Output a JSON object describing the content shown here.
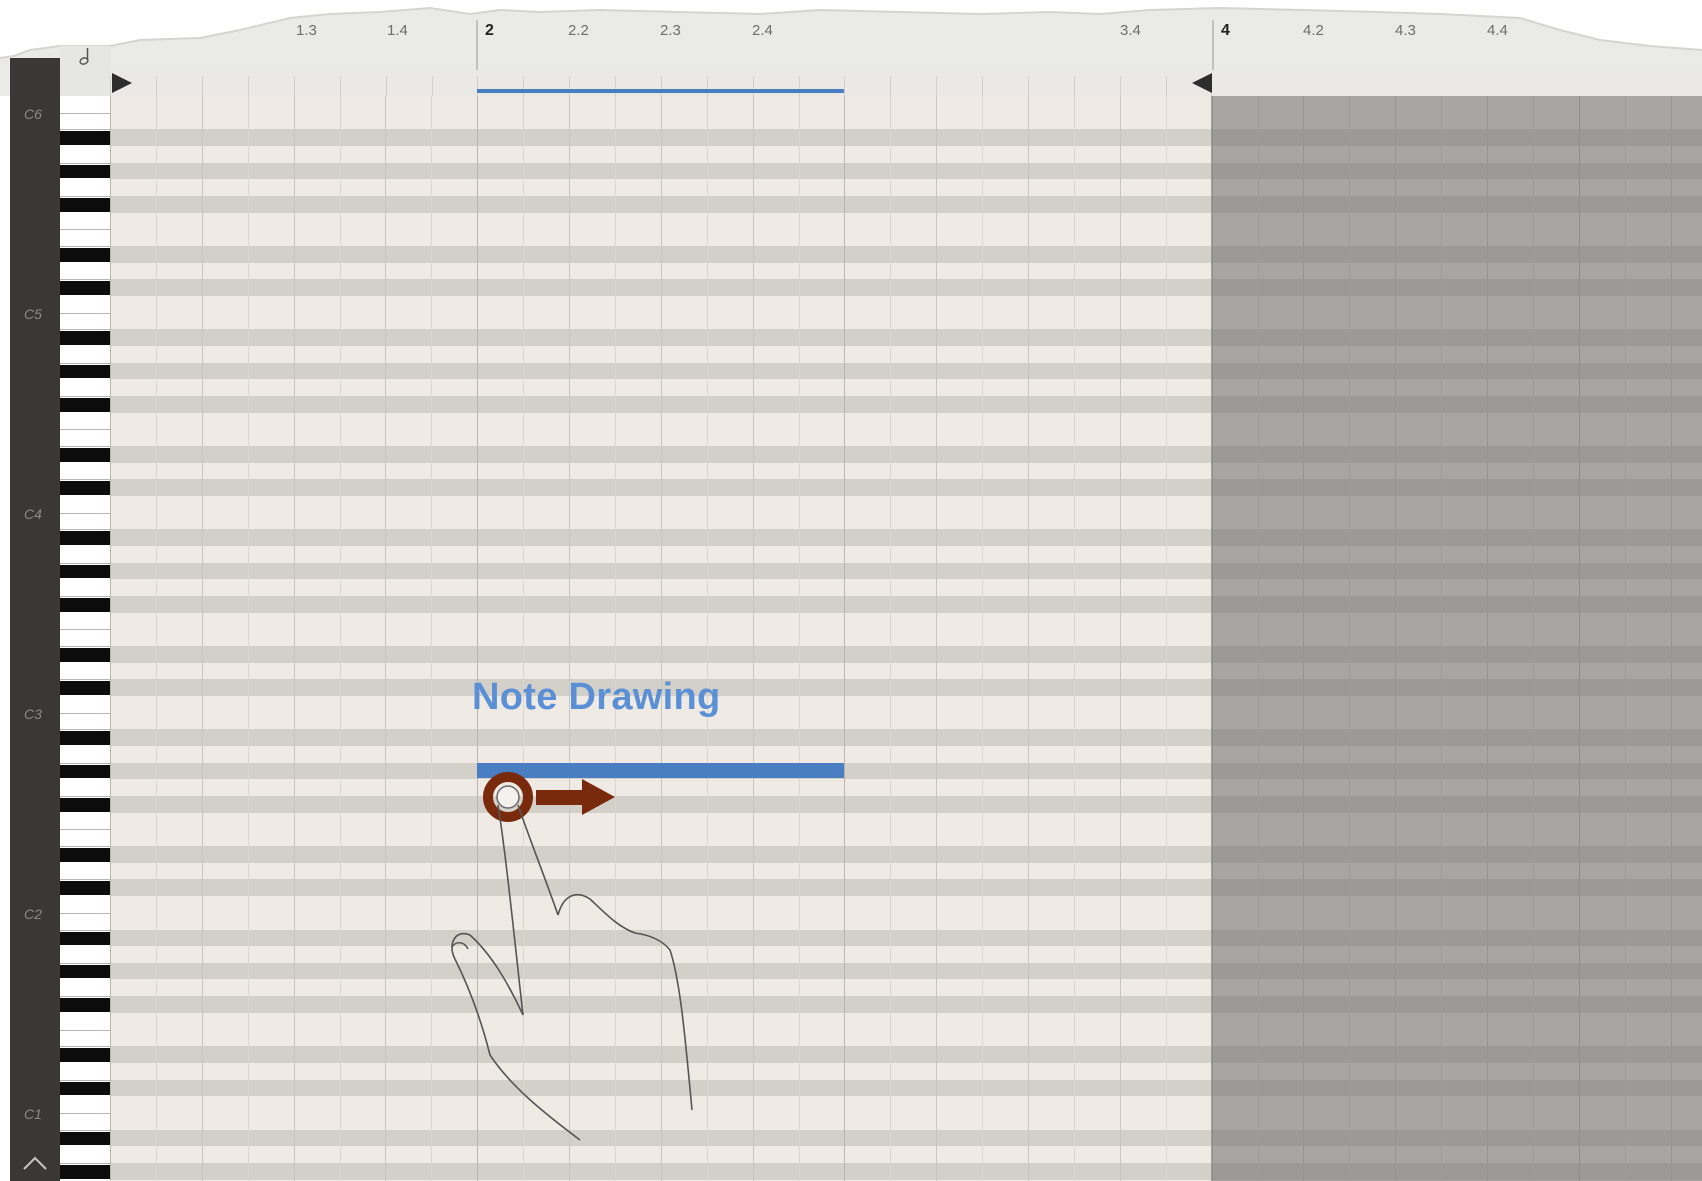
{
  "ruler": {
    "labels": [
      "1.3",
      "1.4",
      "2",
      "2.2",
      "2.3",
      "2.4",
      "3.4",
      "4",
      "4.2",
      "4.3",
      "4.4"
    ]
  },
  "keys": {
    "labels": [
      "C6",
      "C5",
      "C4",
      "C3",
      "C2",
      "C1"
    ]
  },
  "overlay": {
    "title": "Note Drawing"
  },
  "icons": {
    "note_value": "half-note-icon",
    "loop_start": "play-right-icon",
    "loop_end": "play-left-icon",
    "gesture": "hand-drag-gesture-icon",
    "collapse": "chevron-up-icon"
  },
  "colors": {
    "note": "#4a7ec2",
    "label": "#5b8fd6",
    "gesture": "#7a2a0c"
  }
}
